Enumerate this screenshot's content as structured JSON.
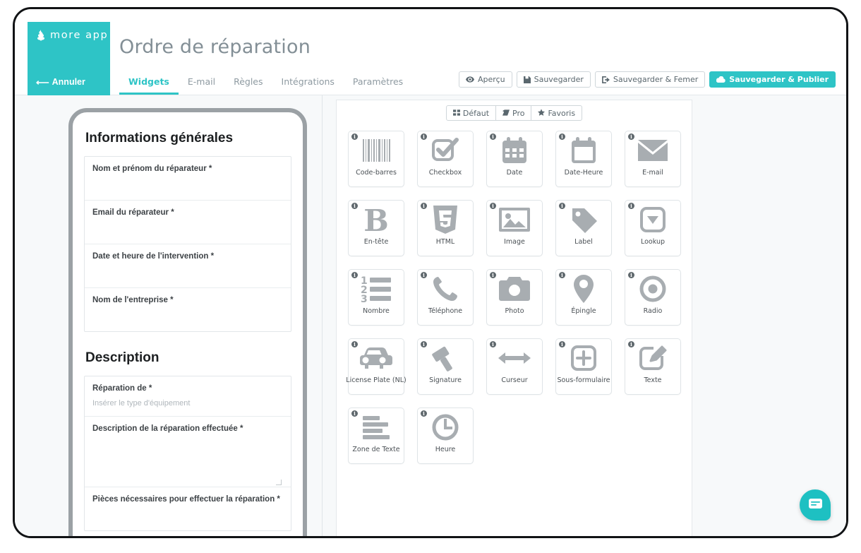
{
  "brand": {
    "name": "more app",
    "logo_icon": "moreapp-leaf-logo",
    "cancel_label": "Annuler",
    "accent_color": "#2ec4c6"
  },
  "header": {
    "title": "Ordre de réparation",
    "tabs": [
      {
        "label": "Widgets",
        "active": true
      },
      {
        "label": "E-mail",
        "active": false
      },
      {
        "label": "Règles",
        "active": false
      },
      {
        "label": "Intégrations",
        "active": false
      },
      {
        "label": "Paramètres",
        "active": false
      }
    ],
    "actions": [
      {
        "label": "Aperçu",
        "icon": "eye-icon",
        "primary": false
      },
      {
        "label": "Sauvegarder",
        "icon": "floppy-disk-icon",
        "primary": false
      },
      {
        "label": "Sauvegarder & Femer",
        "icon": "exit-icon",
        "primary": false
      },
      {
        "label": "Sauvegarder & Publier",
        "icon": "cloud-upload-icon",
        "primary": true
      }
    ]
  },
  "preview": {
    "sections": [
      {
        "title": "Informations générales",
        "fields": [
          {
            "label": "Nom et prénom du réparateur *",
            "placeholder": "",
            "size": "normal"
          },
          {
            "label": "Email du réparateur *",
            "placeholder": "",
            "size": "normal"
          },
          {
            "label": "Date et heure de l'intervention *",
            "placeholder": "",
            "size": "normal"
          },
          {
            "label": "Nom de l'entreprise *",
            "placeholder": "",
            "size": "normal"
          }
        ]
      },
      {
        "title": "Description",
        "fields": [
          {
            "label": "Réparation de *",
            "placeholder": "Insérer le type d'équipement",
            "size": "short"
          },
          {
            "label": "Description de la réparation effectuée *",
            "placeholder": "",
            "size": "tall"
          },
          {
            "label": "Pièces nécessaires pour effectuer la réparation *",
            "placeholder": "",
            "size": "normal"
          }
        ]
      }
    ]
  },
  "widgets": {
    "filters": [
      {
        "label": "Défaut",
        "icon": "grid-icon"
      },
      {
        "label": "Pro",
        "icon": "tag-icon"
      },
      {
        "label": "Favoris",
        "icon": "star-icon"
      }
    ],
    "items": [
      {
        "label": "Code-barres",
        "icon": "barcode-icon"
      },
      {
        "label": "Checkbox",
        "icon": "checkbox-icon"
      },
      {
        "label": "Date",
        "icon": "calendar-icon"
      },
      {
        "label": "Date-Heure",
        "icon": "calendar-blank-icon"
      },
      {
        "label": "E-mail",
        "icon": "envelope-icon"
      },
      {
        "label": "En-tête",
        "icon": "letter-b-icon"
      },
      {
        "label": "HTML",
        "icon": "html5-icon"
      },
      {
        "label": "Image",
        "icon": "image-icon"
      },
      {
        "label": "Label",
        "icon": "price-tag-icon"
      },
      {
        "label": "Lookup",
        "icon": "dropdown-icon"
      },
      {
        "label": "Nombre",
        "icon": "numbered-list-icon"
      },
      {
        "label": "Téléphone",
        "icon": "phone-icon"
      },
      {
        "label": "Photo",
        "icon": "camera-icon"
      },
      {
        "label": "Épingle",
        "icon": "map-pin-icon"
      },
      {
        "label": "Radio",
        "icon": "radio-button-icon"
      },
      {
        "label": "License Plate (NL)",
        "icon": "car-icon"
      },
      {
        "label": "Signature",
        "icon": "signature-pen-icon"
      },
      {
        "label": "Curseur",
        "icon": "slider-arrows-icon"
      },
      {
        "label": "Sous-formulaire",
        "icon": "plus-box-icon"
      },
      {
        "label": "Texte",
        "icon": "text-edit-icon"
      },
      {
        "label": "Zone de Texte",
        "icon": "paragraph-lines-icon"
      },
      {
        "label": "Heure",
        "icon": "clock-icon"
      }
    ],
    "info_badge": "i"
  },
  "chat": {
    "icon": "chat-message-icon",
    "color": "#1ec0c2"
  }
}
